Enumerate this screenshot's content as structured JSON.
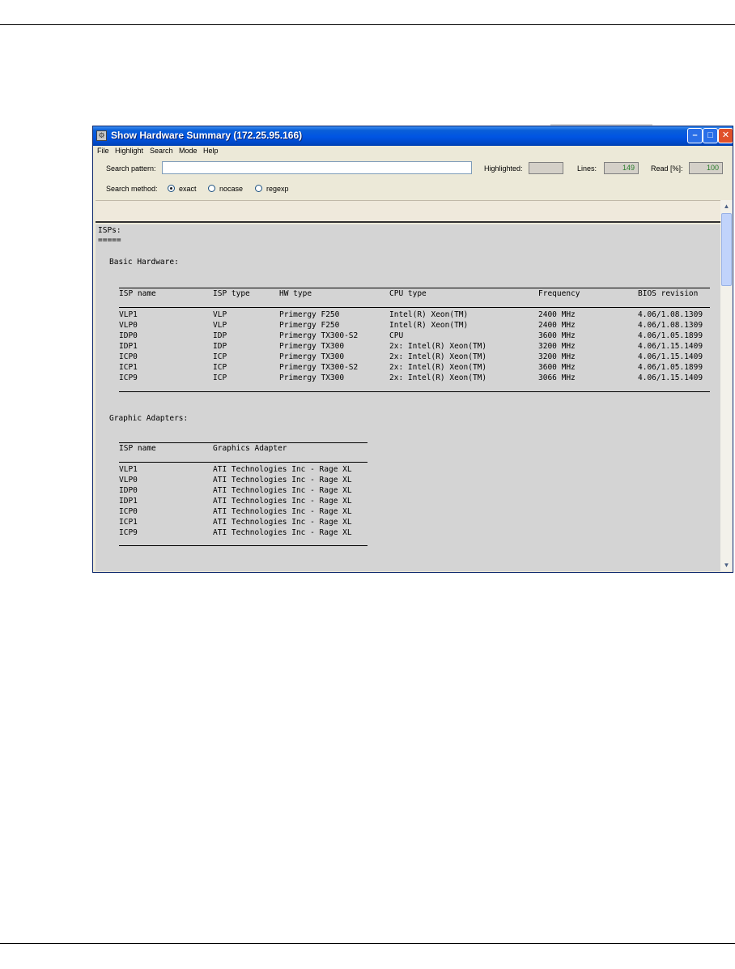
{
  "window": {
    "title": "Show Hardware Summary (172.25.95.166)"
  },
  "menu": [
    "File",
    "Highlight",
    "Search",
    "Mode",
    "Help"
  ],
  "search": {
    "pattern_label": "Search pattern:",
    "pattern_value": "",
    "highlighted_label": "Highlighted:",
    "highlighted_value": "",
    "lines_label": "Lines:",
    "lines_value": "149",
    "read_label": "Read [%]:",
    "read_value": "100",
    "method_label": "Search method:",
    "methods": [
      "exact",
      "nocase",
      "regexp"
    ],
    "selected_method": "exact"
  },
  "content": {
    "heading": "ISPs:",
    "heading_underline": "=====",
    "basic": {
      "title": "Basic Hardware:",
      "columns": [
        "ISP name",
        "ISP type",
        "HW type",
        "CPU type",
        "Frequency",
        "BIOS revision"
      ],
      "rows": [
        [
          "VLP1",
          "VLP",
          "Primergy F250",
          "Intel(R) Xeon(TM)",
          "2400 MHz",
          "4.06/1.08.1309"
        ],
        [
          "VLP0",
          "VLP",
          "Primergy F250",
          "Intel(R) Xeon(TM)",
          "2400 MHz",
          "4.06/1.08.1309"
        ],
        [
          "IDP0",
          "IDP",
          "Primergy TX300-S2",
          "CPU",
          "3600 MHz",
          "4.06/1.05.1899"
        ],
        [
          "IDP1",
          "IDP",
          "Primergy TX300",
          "2x: Intel(R) Xeon(TM)",
          "3200 MHz",
          "4.06/1.15.1409"
        ],
        [
          "ICP0",
          "ICP",
          "Primergy TX300",
          "2x: Intel(R) Xeon(TM)",
          "3200 MHz",
          "4.06/1.15.1409"
        ],
        [
          "ICP1",
          "ICP",
          "Primergy TX300-S2",
          "2x: Intel(R) Xeon(TM)",
          "3600 MHz",
          "4.06/1.05.1899"
        ],
        [
          "ICP9",
          "ICP",
          "Primergy TX300",
          "2x: Intel(R) Xeon(TM)",
          "3066 MHz",
          "4.06/1.15.1409"
        ]
      ]
    },
    "graphic": {
      "title": "Graphic Adapters:",
      "columns": [
        "ISP name",
        "Graphics Adapter"
      ],
      "rows": [
        [
          "VLP1",
          "ATI Technologies Inc - Rage XL"
        ],
        [
          "VLP0",
          "ATI Technologies Inc - Rage XL"
        ],
        [
          "IDP0",
          "ATI Technologies Inc - Rage XL"
        ],
        [
          "IDP1",
          "ATI Technologies Inc - Rage XL"
        ],
        [
          "ICP0",
          "ATI Technologies Inc - Rage XL"
        ],
        [
          "ICP1",
          "ATI Technologies Inc - Rage XL"
        ],
        [
          "ICP9",
          "ATI Technologies Inc - Rage XL"
        ]
      ]
    }
  }
}
